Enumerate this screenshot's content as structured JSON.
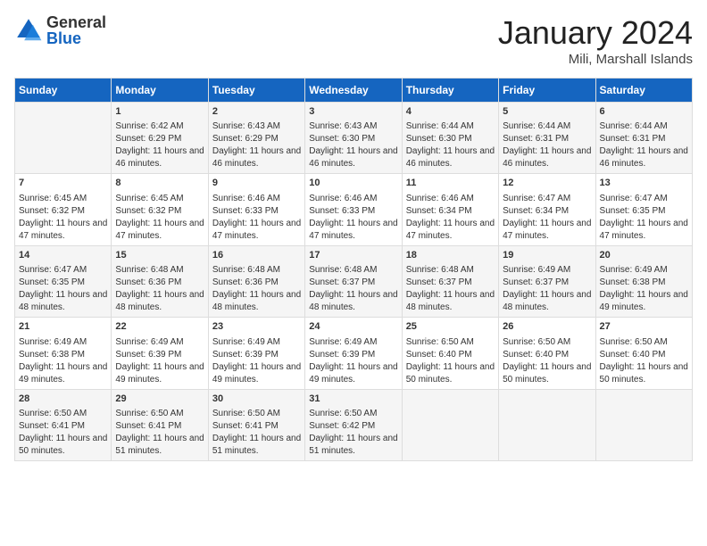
{
  "header": {
    "logo_general": "General",
    "logo_blue": "Blue",
    "month_title": "January 2024",
    "location": "Mili, Marshall Islands"
  },
  "days_of_week": [
    "Sunday",
    "Monday",
    "Tuesday",
    "Wednesday",
    "Thursday",
    "Friday",
    "Saturday"
  ],
  "weeks": [
    [
      {
        "day": "",
        "sunrise": "",
        "sunset": "",
        "daylight": ""
      },
      {
        "day": "1",
        "sunrise": "Sunrise: 6:42 AM",
        "sunset": "Sunset: 6:29 PM",
        "daylight": "Daylight: 11 hours and 46 minutes."
      },
      {
        "day": "2",
        "sunrise": "Sunrise: 6:43 AM",
        "sunset": "Sunset: 6:29 PM",
        "daylight": "Daylight: 11 hours and 46 minutes."
      },
      {
        "day": "3",
        "sunrise": "Sunrise: 6:43 AM",
        "sunset": "Sunset: 6:30 PM",
        "daylight": "Daylight: 11 hours and 46 minutes."
      },
      {
        "day": "4",
        "sunrise": "Sunrise: 6:44 AM",
        "sunset": "Sunset: 6:30 PM",
        "daylight": "Daylight: 11 hours and 46 minutes."
      },
      {
        "day": "5",
        "sunrise": "Sunrise: 6:44 AM",
        "sunset": "Sunset: 6:31 PM",
        "daylight": "Daylight: 11 hours and 46 minutes."
      },
      {
        "day": "6",
        "sunrise": "Sunrise: 6:44 AM",
        "sunset": "Sunset: 6:31 PM",
        "daylight": "Daylight: 11 hours and 46 minutes."
      }
    ],
    [
      {
        "day": "7",
        "sunrise": "Sunrise: 6:45 AM",
        "sunset": "Sunset: 6:32 PM",
        "daylight": "Daylight: 11 hours and 47 minutes."
      },
      {
        "day": "8",
        "sunrise": "Sunrise: 6:45 AM",
        "sunset": "Sunset: 6:32 PM",
        "daylight": "Daylight: 11 hours and 47 minutes."
      },
      {
        "day": "9",
        "sunrise": "Sunrise: 6:46 AM",
        "sunset": "Sunset: 6:33 PM",
        "daylight": "Daylight: 11 hours and 47 minutes."
      },
      {
        "day": "10",
        "sunrise": "Sunrise: 6:46 AM",
        "sunset": "Sunset: 6:33 PM",
        "daylight": "Daylight: 11 hours and 47 minutes."
      },
      {
        "day": "11",
        "sunrise": "Sunrise: 6:46 AM",
        "sunset": "Sunset: 6:34 PM",
        "daylight": "Daylight: 11 hours and 47 minutes."
      },
      {
        "day": "12",
        "sunrise": "Sunrise: 6:47 AM",
        "sunset": "Sunset: 6:34 PM",
        "daylight": "Daylight: 11 hours and 47 minutes."
      },
      {
        "day": "13",
        "sunrise": "Sunrise: 6:47 AM",
        "sunset": "Sunset: 6:35 PM",
        "daylight": "Daylight: 11 hours and 47 minutes."
      }
    ],
    [
      {
        "day": "14",
        "sunrise": "Sunrise: 6:47 AM",
        "sunset": "Sunset: 6:35 PM",
        "daylight": "Daylight: 11 hours and 48 minutes."
      },
      {
        "day": "15",
        "sunrise": "Sunrise: 6:48 AM",
        "sunset": "Sunset: 6:36 PM",
        "daylight": "Daylight: 11 hours and 48 minutes."
      },
      {
        "day": "16",
        "sunrise": "Sunrise: 6:48 AM",
        "sunset": "Sunset: 6:36 PM",
        "daylight": "Daylight: 11 hours and 48 minutes."
      },
      {
        "day": "17",
        "sunrise": "Sunrise: 6:48 AM",
        "sunset": "Sunset: 6:37 PM",
        "daylight": "Daylight: 11 hours and 48 minutes."
      },
      {
        "day": "18",
        "sunrise": "Sunrise: 6:48 AM",
        "sunset": "Sunset: 6:37 PM",
        "daylight": "Daylight: 11 hours and 48 minutes."
      },
      {
        "day": "19",
        "sunrise": "Sunrise: 6:49 AM",
        "sunset": "Sunset: 6:37 PM",
        "daylight": "Daylight: 11 hours and 48 minutes."
      },
      {
        "day": "20",
        "sunrise": "Sunrise: 6:49 AM",
        "sunset": "Sunset: 6:38 PM",
        "daylight": "Daylight: 11 hours and 49 minutes."
      }
    ],
    [
      {
        "day": "21",
        "sunrise": "Sunrise: 6:49 AM",
        "sunset": "Sunset: 6:38 PM",
        "daylight": "Daylight: 11 hours and 49 minutes."
      },
      {
        "day": "22",
        "sunrise": "Sunrise: 6:49 AM",
        "sunset": "Sunset: 6:39 PM",
        "daylight": "Daylight: 11 hours and 49 minutes."
      },
      {
        "day": "23",
        "sunrise": "Sunrise: 6:49 AM",
        "sunset": "Sunset: 6:39 PM",
        "daylight": "Daylight: 11 hours and 49 minutes."
      },
      {
        "day": "24",
        "sunrise": "Sunrise: 6:49 AM",
        "sunset": "Sunset: 6:39 PM",
        "daylight": "Daylight: 11 hours and 49 minutes."
      },
      {
        "day": "25",
        "sunrise": "Sunrise: 6:50 AM",
        "sunset": "Sunset: 6:40 PM",
        "daylight": "Daylight: 11 hours and 50 minutes."
      },
      {
        "day": "26",
        "sunrise": "Sunrise: 6:50 AM",
        "sunset": "Sunset: 6:40 PM",
        "daylight": "Daylight: 11 hours and 50 minutes."
      },
      {
        "day": "27",
        "sunrise": "Sunrise: 6:50 AM",
        "sunset": "Sunset: 6:40 PM",
        "daylight": "Daylight: 11 hours and 50 minutes."
      }
    ],
    [
      {
        "day": "28",
        "sunrise": "Sunrise: 6:50 AM",
        "sunset": "Sunset: 6:41 PM",
        "daylight": "Daylight: 11 hours and 50 minutes."
      },
      {
        "day": "29",
        "sunrise": "Sunrise: 6:50 AM",
        "sunset": "Sunset: 6:41 PM",
        "daylight": "Daylight: 11 hours and 51 minutes."
      },
      {
        "day": "30",
        "sunrise": "Sunrise: 6:50 AM",
        "sunset": "Sunset: 6:41 PM",
        "daylight": "Daylight: 11 hours and 51 minutes."
      },
      {
        "day": "31",
        "sunrise": "Sunrise: 6:50 AM",
        "sunset": "Sunset: 6:42 PM",
        "daylight": "Daylight: 11 hours and 51 minutes."
      },
      {
        "day": "",
        "sunrise": "",
        "sunset": "",
        "daylight": ""
      },
      {
        "day": "",
        "sunrise": "",
        "sunset": "",
        "daylight": ""
      },
      {
        "day": "",
        "sunrise": "",
        "sunset": "",
        "daylight": ""
      }
    ]
  ]
}
